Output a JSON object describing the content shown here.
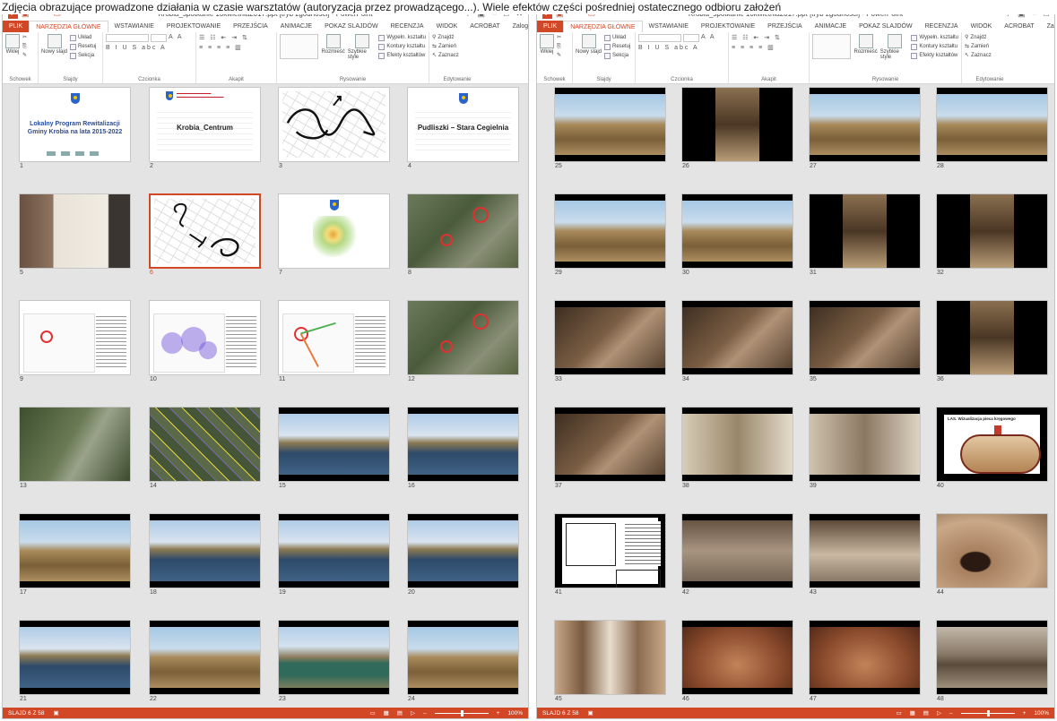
{
  "caption": "Zdjęcia obrazujące prowadzone działania w czasie warsztatów (autoryzacja przez prowadzącego...). Wiele efektów części pośredniej ostatecznego odbioru założeń",
  "colors": {
    "accent": "#d24726",
    "ribbon_bg": "#ffffff",
    "workspace_bg": "#e4e4e4"
  },
  "left_window": {
    "title": "Krobia_spotkanie 10kwietnia2017.ppt [tryb zgodności] - PowerPoint",
    "controls": [
      "?",
      "▣",
      "–",
      "□",
      "✕"
    ],
    "tabs": [
      "PLIK",
      "NARZĘDZIA GŁÓWNE",
      "WSTAWIANIE",
      "PROJEKTOWANIE",
      "PRZEJŚCIA",
      "ANIMACJE",
      "POKAZ SLAJDÓW",
      "RECENZJA",
      "WIDOK",
      "ACROBAT"
    ],
    "login": "Zaloguj się",
    "ribbon": {
      "paste": "Wklej",
      "new_slide": "Nowy slajd",
      "layout": "Układ",
      "reset": "Resetuj",
      "section": "Sekcja",
      "arrange": "Rozmieść",
      "quick_styles": "Szybkie style",
      "shape_fill": "Wypełn. kształtu",
      "shape_outline": "Kontury kształtu",
      "shape_effects": "Efekty kształtów",
      "find": "Znajdź",
      "replace": "Zamień",
      "select": "Zaznacz",
      "groups": [
        "Schowek",
        "Slajdy",
        "Czcionka",
        "Akapit",
        "Rysowanie",
        "Edytowanie"
      ]
    },
    "status": {
      "slide": "SLAJD 6 Z 58",
      "zoom": "100%"
    },
    "slides": [
      {
        "num": "1",
        "title": "Lokalny Program Rewitalizacji Gminy Krobia na lata 2015-2022"
      },
      {
        "num": "2",
        "title": "Krobia_Centrum"
      },
      {
        "num": "3"
      },
      {
        "num": "4",
        "title": "Pudliszki – Stara Cegielnia"
      },
      {
        "num": "5"
      },
      {
        "num": "6"
      },
      {
        "num": "7"
      },
      {
        "num": "8"
      },
      {
        "num": "9"
      },
      {
        "num": "10"
      },
      {
        "num": "11"
      },
      {
        "num": "12"
      },
      {
        "num": "13"
      },
      {
        "num": "14"
      },
      {
        "num": "15"
      },
      {
        "num": "16"
      },
      {
        "num": "17"
      },
      {
        "num": "18"
      },
      {
        "num": "19"
      },
      {
        "num": "20"
      },
      {
        "num": "21"
      },
      {
        "num": "22"
      },
      {
        "num": "23"
      },
      {
        "num": "24"
      }
    ]
  },
  "right_window": {
    "title": "Krobia_spotkanie 10kwietnia2017.ppt [tryb zgodności] - PowerPoint",
    "controls": [
      "?",
      "▣",
      "–",
      "□"
    ],
    "tabs": [
      "PLIK",
      "NARZĘDZIA GŁÓWNE",
      "WSTAWIANIE",
      "PROJEKTOWANIE",
      "PRZEJŚCIA",
      "ANIMACJE",
      "POKAZ SLAJDÓW",
      "RECENZJA",
      "WIDOK",
      "ACROBAT"
    ],
    "login": "Zaloguj",
    "status": {
      "slide": "SLAJD 6 Z 58",
      "zoom": "100%"
    },
    "slides": [
      {
        "num": "25"
      },
      {
        "num": "26"
      },
      {
        "num": "27"
      },
      {
        "num": "28"
      },
      {
        "num": "29"
      },
      {
        "num": "30"
      },
      {
        "num": "31"
      },
      {
        "num": "32"
      },
      {
        "num": "33"
      },
      {
        "num": "34"
      },
      {
        "num": "35"
      },
      {
        "num": "36"
      },
      {
        "num": "37"
      },
      {
        "num": "38"
      },
      {
        "num": "39"
      },
      {
        "num": "40",
        "title": "LAS. Wizualizacja pieca kręgowego"
      },
      {
        "num": "41"
      },
      {
        "num": "42"
      },
      {
        "num": "43"
      },
      {
        "num": "44"
      },
      {
        "num": "45"
      },
      {
        "num": "46"
      },
      {
        "num": "47"
      },
      {
        "num": "48"
      }
    ]
  }
}
